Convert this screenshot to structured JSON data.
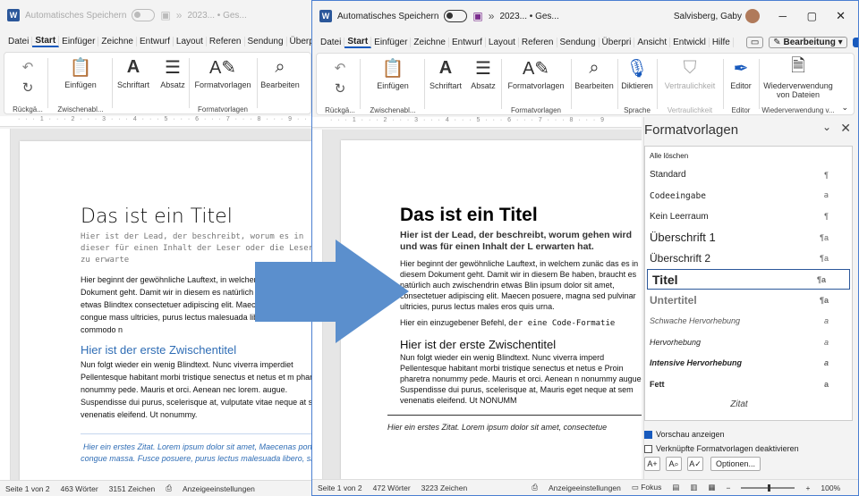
{
  "left": {
    "autosave_label": "Automatisches Speichern",
    "file_title": "2023... • Ges...",
    "menu": [
      "Datei",
      "Start",
      "Einfüger",
      "Zeichne",
      "Entwurf",
      "Layout",
      "Referen",
      "Sendung",
      "Überpri"
    ],
    "ribbon": {
      "undo_group": "Rückgä...",
      "clipboard_group": "Zwischenabl...",
      "paste": "Einfügen",
      "font": "Schriftart",
      "paragraph": "Absatz",
      "styles": "Formatvorlagen",
      "styles_group": "Formatvorlagen",
      "edit": "Bearbeiten"
    },
    "doc": {
      "title": "Das ist ein Titel",
      "lead": "Hier ist der Lead, der beschreibt, worum es in dieser für einen Inhalt der Leser oder die Leserin zu erwarte",
      "body1": "Hier beginnt der gewöhnliche Lauftext, in welcher in diesem Dokument geht. Damit wir in diesem es natürlich auch zwischendrin etwas Blindtex consectetuer adipiscing elit. Maecenas porttitor congue mass ultricies, purus lectus malesuada libero, sit amet commodo n",
      "heading": "Hier ist der erste Zwischentitel",
      "body2": "Nun folgt wieder ein wenig Blindtext. Nunc viverra imperdiet Pellentesque habitant morbi tristique senectus et netus et m pharetra nonummy pede. Mauris et orci. Aenean nec lorem. augue. Suspendisse dui purus, scelerisque at, vulputate vitae neque at sem venenatis eleifend. Ut nonummy.",
      "quote": "Hier ein erstes Zitat. Lorem ipsum dolor sit amet, Maecenas porttitor congue massa. Fusce posuere, purus lectus malesuada libero, sit am"
    },
    "status": {
      "page": "Seite 1 von 2",
      "words": "463 Wörter",
      "chars": "3151 Zeichen",
      "display": "Anzeigeeinstellungen"
    }
  },
  "right": {
    "autosave_label": "Automatisches Speichern",
    "file_title": "2023... • Ges...",
    "user": "Salvisberg, Gaby",
    "menu": [
      "Datei",
      "Start",
      "Einfüger",
      "Zeichne",
      "Entwurf",
      "Layout",
      "Referen",
      "Sendung",
      "Überpri",
      "Ansicht",
      "Entwickl",
      "Hilfe"
    ],
    "editing_mode": "Bearbeitung",
    "ribbon": {
      "undo_group": "Rückgä...",
      "clipboard_group": "Zwischenabl...",
      "paste": "Einfügen",
      "font": "Schriftart",
      "paragraph": "Absatz",
      "styles": "Formatvorlagen",
      "styles_group": "Formatvorlagen",
      "edit": "Bearbeiten",
      "dictate": "Diktieren",
      "speech_group": "Sprache",
      "confidentiality": "Vertraulichkeit",
      "confidentiality_group": "Vertraulichkeit",
      "editor": "Editor",
      "editor_group": "Editor",
      "reuse": "Wiederverwendung von Dateien",
      "reuse_group": "Wiederverwendung v..."
    },
    "doc": {
      "title": "Das ist ein Titel",
      "lead": "Hier ist der Lead, der beschreibt, worum gehen wird und was für einen Inhalt der L erwarten hat.",
      "body1": "Hier beginnt der gewöhnliche Lauftext, in welchem zunäc das es in diesem Dokument geht. Damit wir in diesem Be haben, braucht es natürlich auch zwischendrin etwas Blin ipsum dolor sit amet, consectetuer adipiscing elit. Maecen posuere, magna sed pulvinar ultricies, purus lectus males eros quis urna.",
      "code_prefix": "Hier ein einzugebener Befehl, ",
      "code": "der eine Code-Formatie",
      "heading": "Hier ist der erste Zwischentitel",
      "body2": "Nun folgt wieder ein wenig Blindtext. Nunc viverra imperd Pellentesque habitant morbi tristique senectus et netus e Proin pharetra nonummy pede. Mauris et orci. Aenean n nonummy augue. Suspendisse dui purus, scelerisque at, Mauris eget neque at sem venenatis eleifend. Ut NONUMM",
      "quote": "Hier ein erstes Zitat. Lorem ipsum dolor sit amet, consectetue"
    },
    "pane": {
      "title": "Formatvorlagen",
      "styles": [
        {
          "name": "Alle löschen",
          "sym": ""
        },
        {
          "name": "Standard",
          "sym": "¶"
        },
        {
          "name": "Codeeingabe",
          "sym": "a"
        },
        {
          "name": "Kein Leerraum",
          "sym": "¶"
        },
        {
          "name": "Überschrift 1",
          "sym": "¶a"
        },
        {
          "name": "Überschrift 2",
          "sym": "¶a"
        },
        {
          "name": "Titel",
          "sym": "¶a"
        },
        {
          "name": "Untertitel",
          "sym": "¶a"
        },
        {
          "name": "Schwache Hervorhebung",
          "sym": "a"
        },
        {
          "name": "Hervorhebung",
          "sym": "a"
        },
        {
          "name": "Intensive Hervorhebung",
          "sym": "a"
        },
        {
          "name": "Fett",
          "sym": "a"
        },
        {
          "name": "Zitat",
          "sym": ""
        }
      ],
      "preview_label": "Vorschau anzeigen",
      "linked_label": "Verknüpfte Formatvorlagen deaktivieren",
      "options_label": "Optionen..."
    },
    "status": {
      "page": "Seite 1 von 2",
      "words": "472 Wörter",
      "chars": "3223 Zeichen",
      "display": "Anzeigeeinstellungen",
      "focus": "Fokus",
      "zoom": "100%"
    }
  },
  "colors": {
    "accent": "#185abd",
    "arrow": "#5b8fcd",
    "heading_blue": "#2f6db5"
  }
}
